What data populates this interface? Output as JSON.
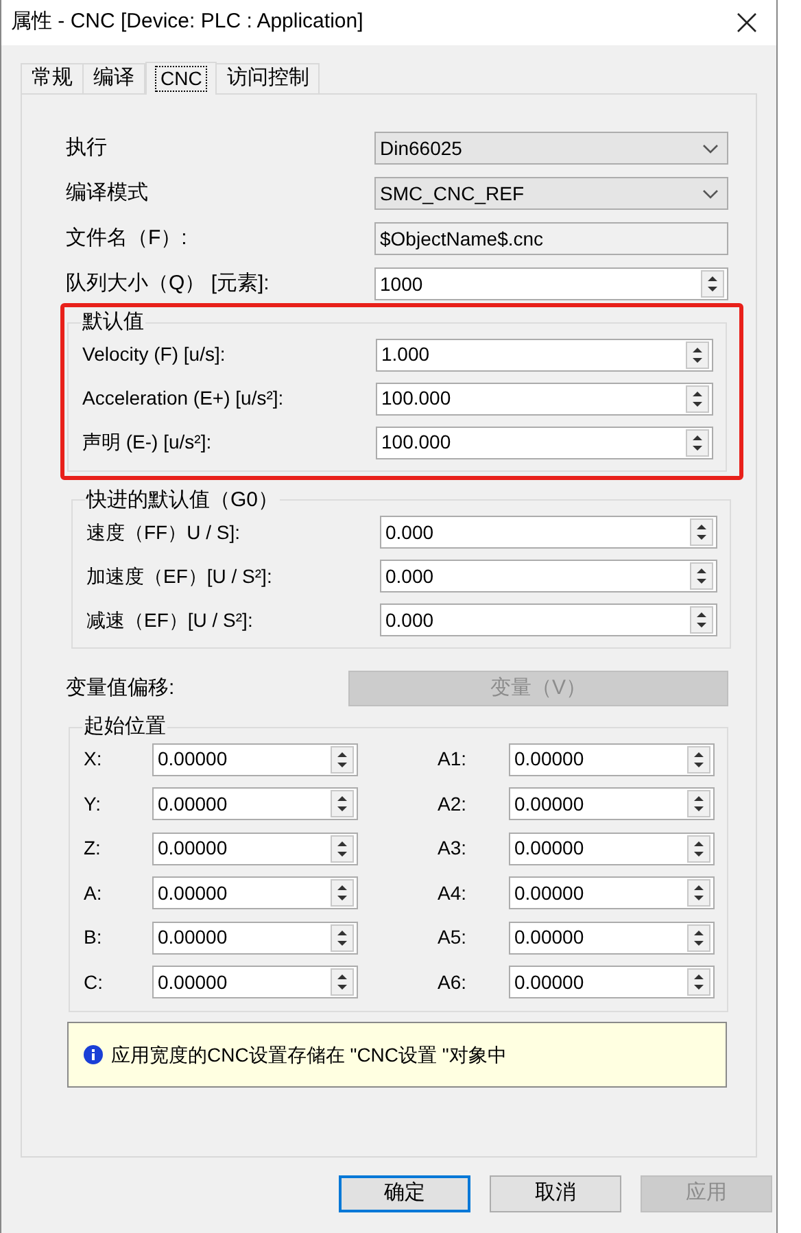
{
  "window": {
    "title": "属性 - CNC [Device: PLC : Application]"
  },
  "tabs": [
    {
      "label": "常规",
      "selected": false
    },
    {
      "label": "编译",
      "selected": false
    },
    {
      "label": "CNC",
      "selected": true
    },
    {
      "label": "访问控制",
      "selected": false
    }
  ],
  "fields": [
    {
      "kind": "dropdown",
      "label": "执行",
      "value": "Din66025"
    },
    {
      "kind": "dropdown",
      "label": "编译模式",
      "value": "SMC_CNC_REF"
    },
    {
      "kind": "text",
      "label": "文件名（F）:",
      "value": "$ObjectName$.cnc"
    },
    {
      "kind": "spinner",
      "label": "队列大小（Q） [元素]:",
      "value": "1000"
    }
  ],
  "default_values": {
    "title": "默认值",
    "highlighted": true,
    "fields": [
      {
        "label": "Velocity (F) [u/s]:",
        "value": "1.000"
      },
      {
        "label": "Acceleration (E+) [u/s²]:",
        "value": "100.000"
      },
      {
        "label": "声明 (E-) [u/s²]:",
        "value": "100.000"
      }
    ]
  },
  "rapid_defaults": {
    "title": "快进的默认值（G0）",
    "highlighted": false,
    "fields": [
      {
        "label": "速度（FF）U / S]:",
        "value": "0.000"
      },
      {
        "label": "加速度（EF）[U / S²]:",
        "value": "0.000"
      },
      {
        "label": "减速（EF）[U / S²]:",
        "value": "0.000"
      }
    ]
  },
  "variable_offset": {
    "label": "变量值偏移:",
    "button": {
      "label": "变量（V）",
      "disabled": true
    }
  },
  "start_position": {
    "title": "起始位置",
    "rows": [
      {
        "left": {
          "label": "X:",
          "value": "0.00000"
        },
        "right": {
          "label": "A1:",
          "value": "0.00000"
        }
      },
      {
        "left": {
          "label": "Y:",
          "value": "0.00000"
        },
        "right": {
          "label": "A2:",
          "value": "0.00000"
        }
      },
      {
        "left": {
          "label": "Z:",
          "value": "0.00000"
        },
        "right": {
          "label": "A3:",
          "value": "0.00000"
        }
      },
      {
        "left": {
          "label": "A:",
          "value": "0.00000"
        },
        "right": {
          "label": "A4:",
          "value": "0.00000"
        }
      },
      {
        "left": {
          "label": "B:",
          "value": "0.00000"
        },
        "right": {
          "label": "A5:",
          "value": "0.00000"
        }
      },
      {
        "left": {
          "label": "C:",
          "value": "0.00000"
        },
        "right": {
          "label": "A6:",
          "value": "0.00000"
        }
      }
    ]
  },
  "info": {
    "text": "应用宽度的CNC设置存储在 \"CNC设置 \"对象中"
  },
  "buttons": [
    {
      "label": "确定",
      "default": true,
      "disabled": false
    },
    {
      "label": "取消",
      "default": false,
      "disabled": false
    },
    {
      "label": "应用",
      "default": false,
      "disabled": true
    }
  ]
}
